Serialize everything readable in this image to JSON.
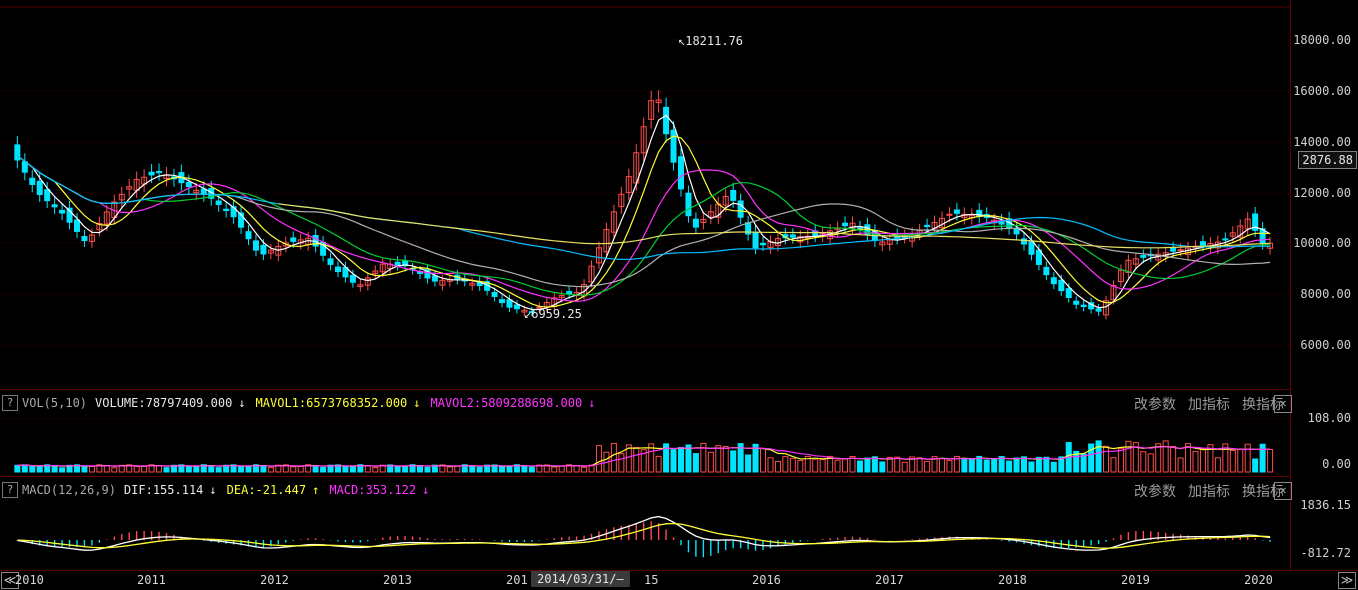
{
  "price_axis": {
    "ticks": [
      "18000.00",
      "16000.00",
      "14000.00",
      "12000.00",
      "10000.00",
      "8000.00",
      "6000.00"
    ],
    "current": "2876.88"
  },
  "annotations": {
    "high": "18211.76",
    "low": "6959.25"
  },
  "volume": {
    "help": "?",
    "name": "VOL(5,10)",
    "volume": "VOLUME:78797409.000",
    "volume_arrow": "↓",
    "mavol1": "MAVOL1:6573768352.000",
    "mavol1_arrow": "↓",
    "mavol2": "MAVOL2:5809288698.000",
    "mavol2_arrow": "↓",
    "axis_top": "108.00",
    "axis_bottom": "0.00"
  },
  "macd": {
    "help": "?",
    "name": "MACD(12,26,9)",
    "dif": "DIF:155.114",
    "dif_arrow": "↓",
    "dea": "DEA:-21.447",
    "dea_arrow": "↑",
    "macd": "MACD:353.122",
    "macd_arrow": "↓",
    "axis_top": "1836.15",
    "axis_bottom": "-812.72"
  },
  "tools": {
    "modify": "改参数",
    "add": "加指标",
    "switch": "换指标",
    "close": "✕"
  },
  "xaxis": {
    "labels": [
      "2010",
      "2011",
      "2012",
      "2013",
      "201",
      "2016",
      "2017",
      "2018",
      "2019",
      "2020"
    ],
    "tooltip": "2014/03/31/—",
    "tooltip_tail": "15",
    "prev": "≪",
    "next": "≫"
  },
  "colors": {
    "up": "#ff4d4d",
    "down": "#00e5ff",
    "ma5": "#ffffff",
    "ma10": "#ffff33",
    "ma20": "#ff33ff",
    "ma30": "#00cc33",
    "ma60": "#b0b0b0",
    "ma120": "#00bfff",
    "ma250": "#e8e060"
  },
  "chart_data": {
    "type": "candlestick",
    "ylim": [
      5000,
      19000
    ],
    "series_close_approx": [
      [
        2010.0,
        13600
      ],
      [
        2010.2,
        12000
      ],
      [
        2010.4,
        11200
      ],
      [
        2010.6,
        10000
      ],
      [
        2010.8,
        11500
      ],
      [
        2011.0,
        12500
      ],
      [
        2011.2,
        12800
      ],
      [
        2011.4,
        12300
      ],
      [
        2011.6,
        11800
      ],
      [
        2011.8,
        11000
      ],
      [
        2012.0,
        9500
      ],
      [
        2012.2,
        10000
      ],
      [
        2012.4,
        10200
      ],
      [
        2012.6,
        9000
      ],
      [
        2012.8,
        8300
      ],
      [
        2013.0,
        9200
      ],
      [
        2013.2,
        9100
      ],
      [
        2013.4,
        8500
      ],
      [
        2013.6,
        8600
      ],
      [
        2013.8,
        8300
      ],
      [
        2014.0,
        7500
      ],
      [
        2014.2,
        7300
      ],
      [
        2014.4,
        7900
      ],
      [
        2014.6,
        8100
      ],
      [
        2014.8,
        10500
      ],
      [
        2015.0,
        12800
      ],
      [
        2015.2,
        16200
      ],
      [
        2015.3,
        14000
      ],
      [
        2015.5,
        10500
      ],
      [
        2015.8,
        12000
      ],
      [
        2016.0,
        9800
      ],
      [
        2016.2,
        10200
      ],
      [
        2016.5,
        10300
      ],
      [
        2016.8,
        10800
      ],
      [
        2017.0,
        10000
      ],
      [
        2017.3,
        10400
      ],
      [
        2017.6,
        11200
      ],
      [
        2017.9,
        11000
      ],
      [
        2018.1,
        10500
      ],
      [
        2018.4,
        8500
      ],
      [
        2018.6,
        7600
      ],
      [
        2018.8,
        7300
      ],
      [
        2019.0,
        9300
      ],
      [
        2019.2,
        9500
      ],
      [
        2019.5,
        9800
      ],
      [
        2019.8,
        10100
      ],
      [
        2020.0,
        11000
      ],
      [
        2020.1,
        10000
      ]
    ]
  }
}
